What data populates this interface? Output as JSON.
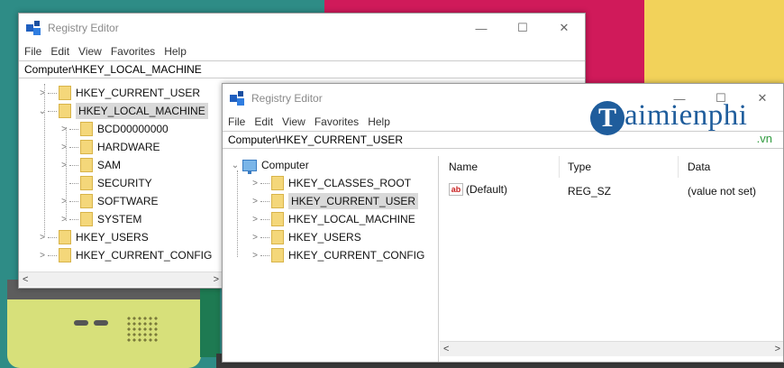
{
  "colors": {
    "selection": "#cce4f7",
    "folder": "#f4d77a",
    "brand": "#1f5d9c",
    "brand_vn": "#2f9a3e"
  },
  "window_back": {
    "title": "Registry Editor",
    "menu": [
      "File",
      "Edit",
      "View",
      "Favorites",
      "Help"
    ],
    "address": "Computer\\HKEY_LOCAL_MACHINE",
    "tree": {
      "hkey_current_user": "HKEY_CURRENT_USER",
      "hkey_local_machine": "HKEY_LOCAL_MACHINE",
      "bcd": "BCD00000000",
      "hardware": "HARDWARE",
      "sam": "SAM",
      "security": "SECURITY",
      "software": "SOFTWARE",
      "system": "SYSTEM",
      "hkey_users": "HKEY_USERS",
      "hkey_current_config": "HKEY_CURRENT_CONFIG"
    },
    "controls": {
      "minimize": "—",
      "maximize": "☐",
      "close": "✕"
    },
    "scroll": {
      "left": "<",
      "right": ">"
    }
  },
  "window_front": {
    "title": "Registry Editor",
    "menu": [
      "File",
      "Edit",
      "View",
      "Favorites",
      "Help"
    ],
    "address": "Computer\\HKEY_CURRENT_USER",
    "tree": {
      "computer": "Computer",
      "hkey_classes_root": "HKEY_CLASSES_ROOT",
      "hkey_current_user": "HKEY_CURRENT_USER",
      "hkey_local_machine": "HKEY_LOCAL_MACHINE",
      "hkey_users": "HKEY_USERS",
      "hkey_current_config": "HKEY_CURRENT_CONFIG"
    },
    "columns": {
      "name": "Name",
      "type": "Type",
      "data": "Data"
    },
    "values": [
      {
        "icon": "ab",
        "name": "(Default)",
        "type": "REG_SZ",
        "data": "(value not set)"
      }
    ],
    "controls": {
      "minimize": "—",
      "maximize": "☐",
      "close": "✕"
    },
    "scroll": {
      "left": "<",
      "right": ">"
    }
  },
  "watermark": {
    "letter": "T",
    "text": "aimienphi",
    "suffix": ".vn"
  }
}
